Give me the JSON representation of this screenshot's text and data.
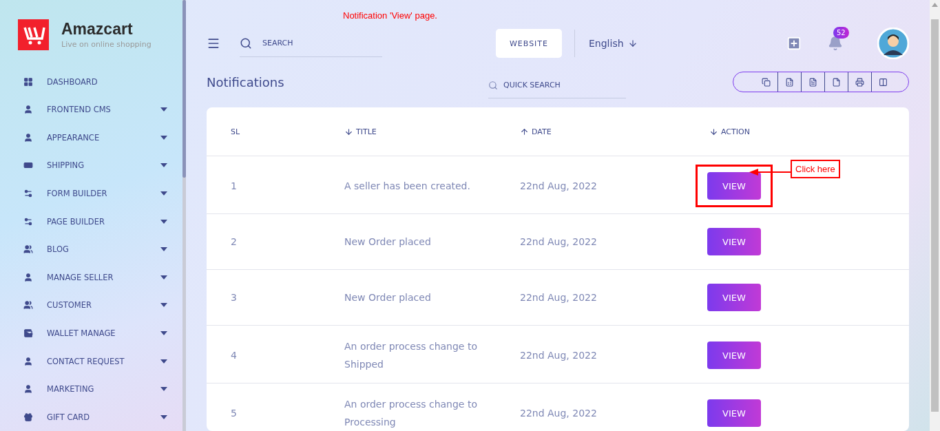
{
  "brand": {
    "name": "Amazcart",
    "tagline": "Live on online shopping"
  },
  "sidebar": {
    "items": [
      {
        "label": "DASHBOARD",
        "has_submenu": false
      },
      {
        "label": "FRONTEND CMS",
        "has_submenu": true
      },
      {
        "label": "APPEARANCE",
        "has_submenu": true
      },
      {
        "label": "SHIPPING",
        "has_submenu": true
      },
      {
        "label": "FORM BUILDER",
        "has_submenu": true
      },
      {
        "label": "PAGE BUILDER",
        "has_submenu": true
      },
      {
        "label": "BLOG",
        "has_submenu": true
      },
      {
        "label": "MANAGE SELLER",
        "has_submenu": true
      },
      {
        "label": "CUSTOMER",
        "has_submenu": true
      },
      {
        "label": "WALLET MANAGE",
        "has_submenu": true
      },
      {
        "label": "CONTACT REQUEST",
        "has_submenu": true
      },
      {
        "label": "MARKETING",
        "has_submenu": true
      },
      {
        "label": "GIFT CARD",
        "has_submenu": true
      }
    ]
  },
  "annotation": {
    "caption": "Notification 'View' page.",
    "callout": "Click here"
  },
  "topbar": {
    "search_placeholder": "SEARCH",
    "website_button": "WEBSITE",
    "language": "English",
    "notification_count": "52"
  },
  "page": {
    "title": "Notifications",
    "quick_search_placeholder": "QUICK SEARCH"
  },
  "table": {
    "columns": [
      {
        "label": "SL",
        "kind": "plain"
      },
      {
        "label": "TITLE",
        "kind": "sort-down"
      },
      {
        "label": "DATE",
        "kind": "sort-up"
      },
      {
        "label": "ACTION",
        "kind": "sort-down"
      }
    ],
    "rows": [
      {
        "sl": "1",
        "title": "A seller has been created.",
        "date": "22nd Aug, 2022",
        "action": "VIEW",
        "highlighted": true
      },
      {
        "sl": "2",
        "title": "New Order placed",
        "date": "22nd Aug, 2022",
        "action": "VIEW",
        "highlighted": false
      },
      {
        "sl": "3",
        "title": "New Order placed",
        "date": "22nd Aug, 2022",
        "action": "VIEW",
        "highlighted": false
      },
      {
        "sl": "4",
        "title": "An order process change to Shipped",
        "date": "22nd Aug, 2022",
        "action": "VIEW",
        "highlighted": false
      },
      {
        "sl": "5",
        "title": "An order process change to Processing",
        "date": "22nd Aug, 2022",
        "action": "VIEW",
        "highlighted": false
      }
    ]
  }
}
